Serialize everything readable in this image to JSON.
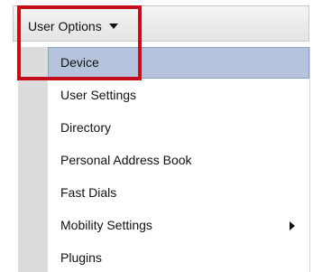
{
  "menu": {
    "title": "User Options",
    "items": [
      {
        "label": "Device",
        "selected": true,
        "has_submenu": false
      },
      {
        "label": "User Settings",
        "selected": false,
        "has_submenu": false
      },
      {
        "label": "Directory",
        "selected": false,
        "has_submenu": false
      },
      {
        "label": "Personal Address Book",
        "selected": false,
        "has_submenu": false
      },
      {
        "label": "Fast Dials",
        "selected": false,
        "has_submenu": false
      },
      {
        "label": "Mobility Settings",
        "selected": false,
        "has_submenu": true
      },
      {
        "label": "Plugins",
        "selected": false,
        "has_submenu": false
      }
    ]
  },
  "colors": {
    "selection_fill": "#b6c3dd",
    "selection_border": "#8c9fc6",
    "callout_border": "#c40e1a",
    "gutter": "#dcdcdc"
  }
}
